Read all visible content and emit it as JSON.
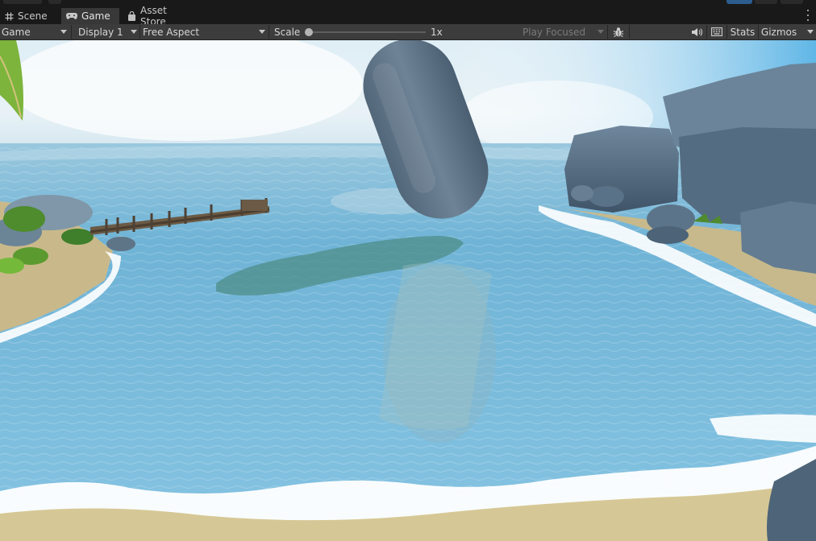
{
  "tabs": [
    {
      "label": "Scene",
      "icon": "grid-icon",
      "active": false
    },
    {
      "label": "Game",
      "icon": "gamepad-icon",
      "active": true
    },
    {
      "label": "Asset Store",
      "icon": "shopping-bag-icon",
      "active": false
    }
  ],
  "toolbar": {
    "view_select": "Game",
    "display_select": "Display 1",
    "aspect_select": "Free Aspect",
    "scale_label": "Scale",
    "scale_value": "1x",
    "play_mode_select": "Play Focused",
    "stats_label": "Stats",
    "gizmos_label": "Gizmos"
  },
  "icons": {
    "bug": "bug-icon",
    "audio": "speaker-icon",
    "stats_grid": "keyboard-grid-icon",
    "more": "kebab-menu-icon"
  },
  "scale_slider": {
    "level": 0.0
  },
  "colors": {
    "panel_bg": "#191919",
    "active_tab": "#383838",
    "toolbar_bg": "#3c3c3c",
    "accent_blue": "#2c5d8f",
    "text": "#d2d2d2",
    "text_dim": "#7a7a7a"
  },
  "viewport": {
    "scene": "tropical bay with wooden pier, rocky cliffs, shallow water and a floating grey capsule"
  }
}
